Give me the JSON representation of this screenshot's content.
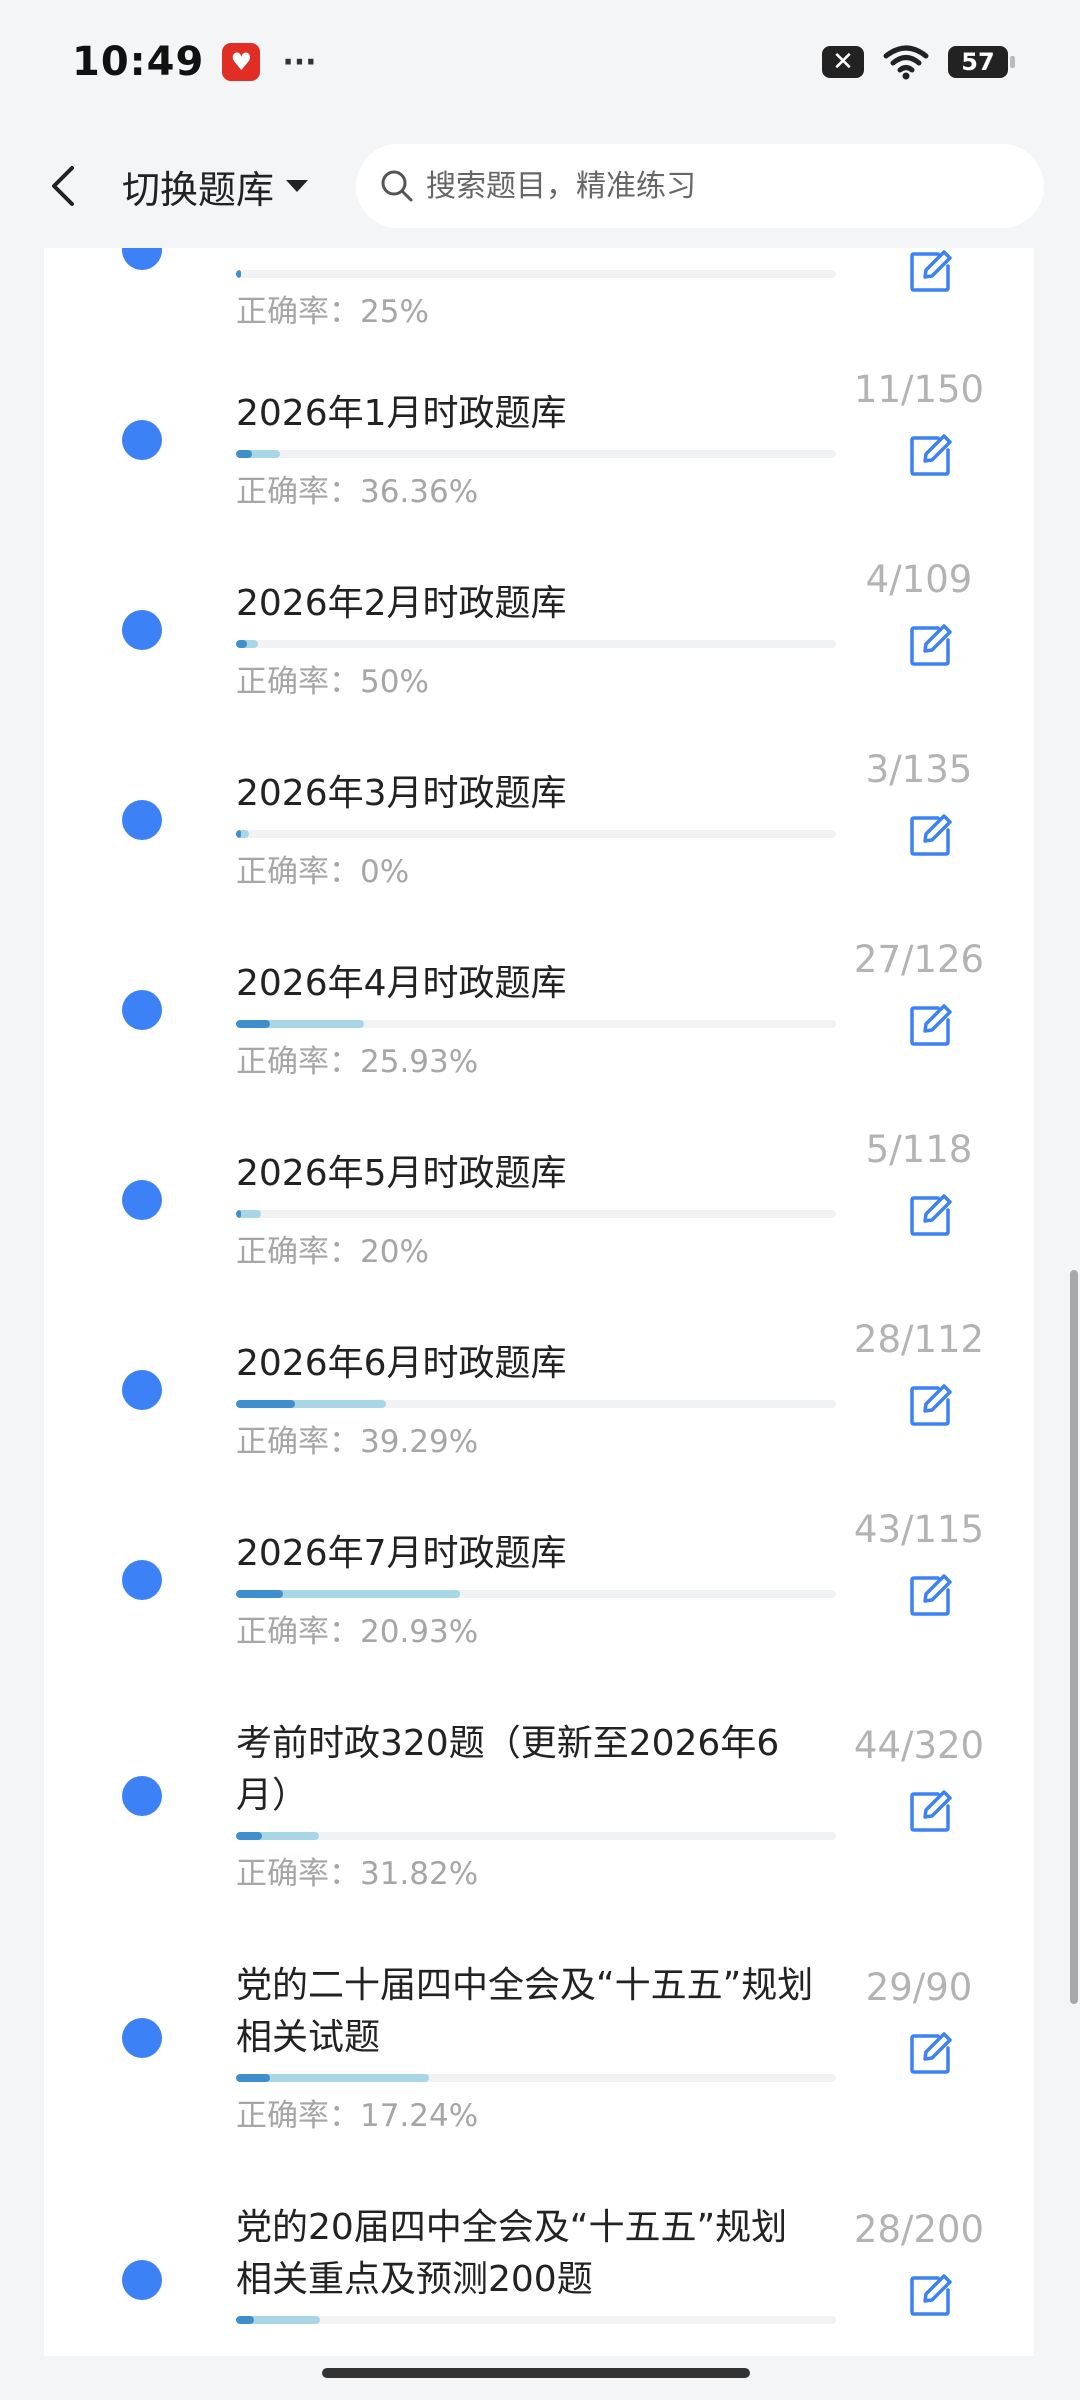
{
  "status_bar": {
    "time": "10:49",
    "battery": "57"
  },
  "header": {
    "switch_label": "切换题库",
    "search_placeholder": "搜索题目，精准练习"
  },
  "colors": {
    "accent": "#3c82f6",
    "progress_light": "#a9d6e4",
    "progress_dark": "#3f8fcf"
  },
  "partial_top": {
    "accuracy": "正确率：25%",
    "progress_done": 0.005,
    "progress_correct": 0.005
  },
  "banks": [
    {
      "title": "2026年1月时政题库",
      "accuracy": "正确率：36.36%",
      "count": "11/150",
      "progress_done": 0.073,
      "progress_correct": 0.027
    },
    {
      "title": "2026年2月时政题库",
      "accuracy": "正确率：50%",
      "count": "4/109",
      "progress_done": 0.037,
      "progress_correct": 0.018
    },
    {
      "title": "2026年3月时政题库",
      "accuracy": "正确率：0%",
      "count": "3/135",
      "progress_done": 0.022,
      "progress_correct": 0.0
    },
    {
      "title": "2026年4月时政题库",
      "accuracy": "正确率：25.93%",
      "count": "27/126",
      "progress_done": 0.214,
      "progress_correct": 0.056
    },
    {
      "title": "2026年5月时政题库",
      "accuracy": "正确率：20%",
      "count": "5/118",
      "progress_done": 0.042,
      "progress_correct": 0.008
    },
    {
      "title": "2026年6月时政题库",
      "accuracy": "正确率：39.29%",
      "count": "28/112",
      "progress_done": 0.25,
      "progress_correct": 0.098
    },
    {
      "title": "2026年7月时政题库",
      "accuracy": "正确率：20.93%",
      "count": "43/115",
      "progress_done": 0.374,
      "progress_correct": 0.078
    },
    {
      "title": "考前时政320题（更新至2026年6月）",
      "accuracy": "正确率：31.82%",
      "count": "44/320",
      "progress_done": 0.1375,
      "progress_correct": 0.044
    },
    {
      "title": "党的二十届四中全会及“十五五”规划相关试题",
      "accuracy": "正确率：17.24%",
      "count": "29/90",
      "progress_done": 0.322,
      "progress_correct": 0.056
    },
    {
      "title": "党的20届四中全会及“十五五”规划相关重点及预测200题",
      "accuracy": "",
      "count": "28/200",
      "progress_done": 0.14,
      "progress_correct": 0.03
    }
  ]
}
